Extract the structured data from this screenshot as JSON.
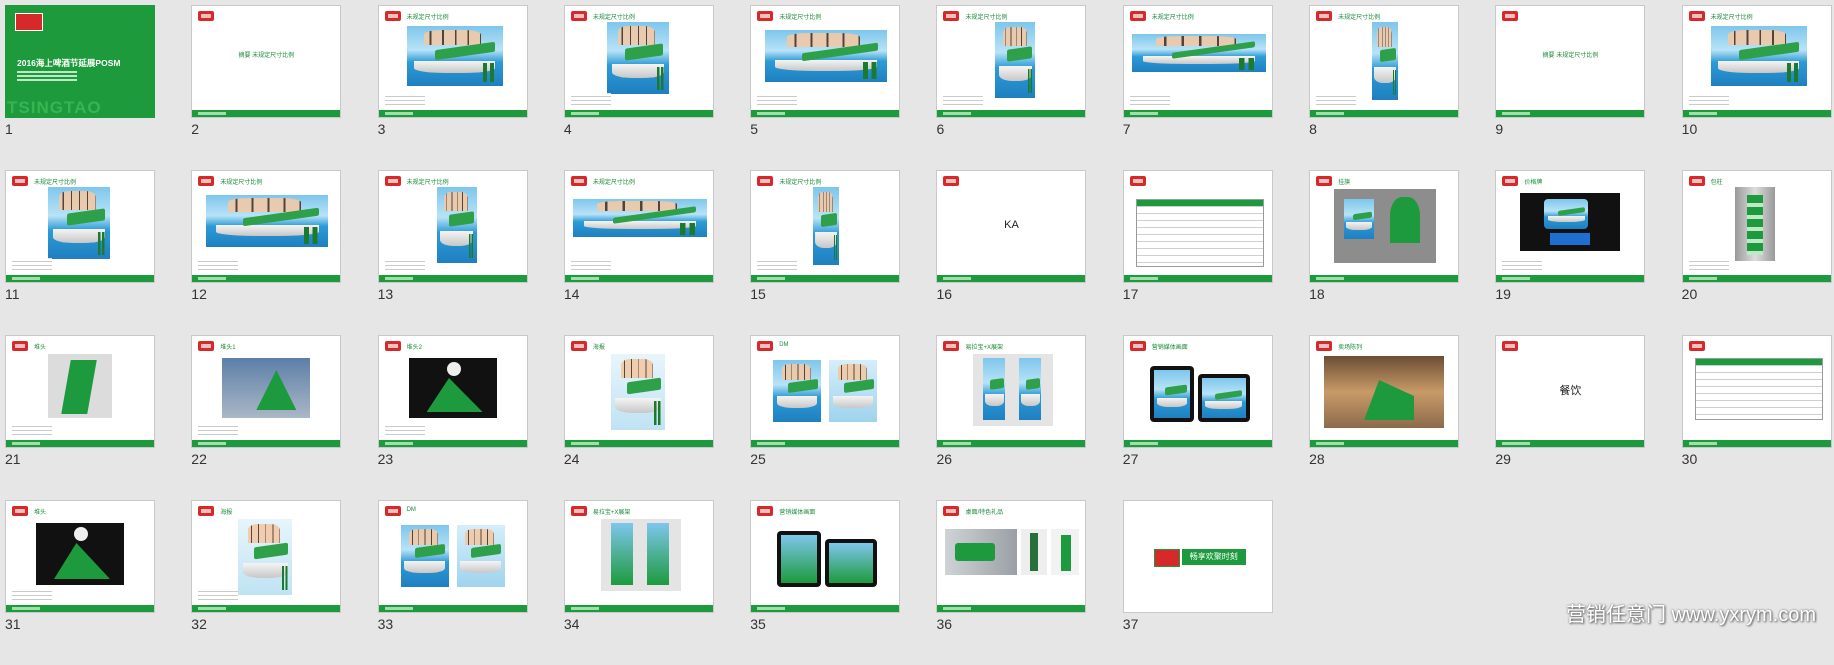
{
  "slides": [
    {
      "num": "1",
      "title": "",
      "cover_title": "2016海上啤酒节延展POSM",
      "cover_brand": "TSINGTAO"
    },
    {
      "num": "2",
      "title": "",
      "center": "摘要 未规定尺寸比例"
    },
    {
      "num": "3",
      "title": "未规定尺寸比例"
    },
    {
      "num": "4",
      "title": "未规定尺寸比例"
    },
    {
      "num": "5",
      "title": "未规定尺寸比例"
    },
    {
      "num": "6",
      "title": "未规定尺寸比例"
    },
    {
      "num": "7",
      "title": "未规定尺寸比例"
    },
    {
      "num": "8",
      "title": "未规定尺寸比例"
    },
    {
      "num": "9",
      "title": "",
      "center": "摘要 未规定尺寸比例"
    },
    {
      "num": "10",
      "title": "未规定尺寸比例"
    },
    {
      "num": "11",
      "title": "未规定尺寸比例"
    },
    {
      "num": "12",
      "title": "未规定尺寸比例"
    },
    {
      "num": "13",
      "title": "未规定尺寸比例"
    },
    {
      "num": "14",
      "title": "未规定尺寸比例"
    },
    {
      "num": "15",
      "title": "未规定尺寸比例"
    },
    {
      "num": "16",
      "title": "",
      "center": "KA"
    },
    {
      "num": "17",
      "title": ""
    },
    {
      "num": "18",
      "title": "挂旗"
    },
    {
      "num": "19",
      "title": "价格牌"
    },
    {
      "num": "20",
      "title": "包柱"
    },
    {
      "num": "21",
      "title": "堆头"
    },
    {
      "num": "22",
      "title": "堆头1"
    },
    {
      "num": "23",
      "title": "堆头2"
    },
    {
      "num": "24",
      "title": "海报"
    },
    {
      "num": "25",
      "title": "DM"
    },
    {
      "num": "26",
      "title": "易拉宝+X展架"
    },
    {
      "num": "27",
      "title": "营销媒体画面"
    },
    {
      "num": "28",
      "title": "卖场陈列"
    },
    {
      "num": "29",
      "title": "",
      "center": "餐饮"
    },
    {
      "num": "30",
      "title": ""
    },
    {
      "num": "31",
      "title": "堆头"
    },
    {
      "num": "32",
      "title": "海报"
    },
    {
      "num": "33",
      "title": "DM"
    },
    {
      "num": "34",
      "title": "易拉宝+X展架"
    },
    {
      "num": "35",
      "title": "营销媒体画面"
    },
    {
      "num": "36",
      "title": "桌面/特色礼品"
    },
    {
      "num": "37",
      "title": "",
      "end_text": "畅享欢聚时刻"
    }
  ],
  "watermark": "营销任意门 www.yxrym.com"
}
